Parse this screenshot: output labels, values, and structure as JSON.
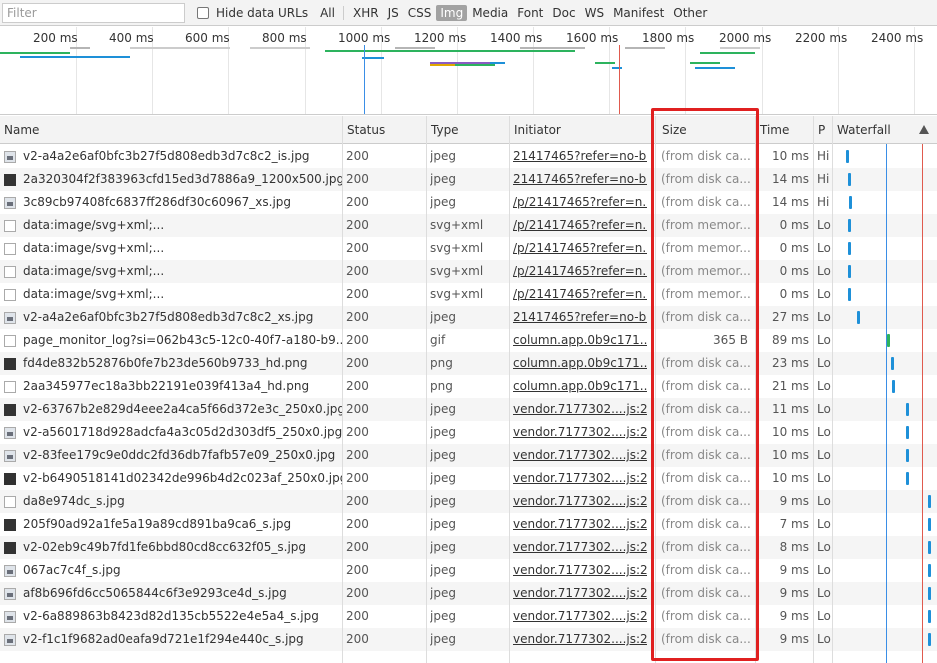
{
  "toolbar": {
    "filter_placeholder": "Filter",
    "hide_data_urls": "Hide data URLs",
    "types": [
      "All",
      "XHR",
      "JS",
      "CSS",
      "Img",
      "Media",
      "Font",
      "Doc",
      "WS",
      "Manifest",
      "Other"
    ],
    "active_type": "Img"
  },
  "overview": {
    "ticks": [
      "200 ms",
      "400 ms",
      "600 ms",
      "800 ms",
      "1000 ms",
      "1200 ms",
      "1400 ms",
      "1600 ms",
      "1800 ms",
      "2000 ms",
      "2200 ms",
      "2400 ms"
    ]
  },
  "columns": {
    "name": "Name",
    "status": "Status",
    "type": "Type",
    "initiator": "Initiator",
    "size": "Size",
    "time": "Time",
    "priority": "P",
    "waterfall": "Waterfall"
  },
  "rows": [
    {
      "name": "v2-a4a2e6af0bfc3b27f5d808edb3d7c8c2_is.jpg",
      "status": "200",
      "type": "jpeg",
      "initiator": "21417465?refer=no-b...",
      "size": "(from disk ca...",
      "time": "10 ms",
      "p": "Hi",
      "icon": "img"
    },
    {
      "name": "2a320304f2f383963cfd15ed3d7886a9_1200x500.jpg",
      "status": "200",
      "type": "jpeg",
      "initiator": "21417465?refer=no-b...",
      "size": "(from disk ca...",
      "time": "14 ms",
      "p": "Hi",
      "icon": "dark"
    },
    {
      "name": "3c89cb97408fc6837ff286df30c60967_xs.jpg",
      "status": "200",
      "type": "jpeg",
      "initiator": "/p/21417465?refer=n...",
      "size": "(from disk ca...",
      "time": "14 ms",
      "p": "Hi",
      "icon": "img"
    },
    {
      "name": "data:image/svg+xml;...",
      "status": "200",
      "type": "svg+xml",
      "initiator": "/p/21417465?refer=n...",
      "size": "(from memor...",
      "time": "0 ms",
      "p": "Lo",
      "icon": "blank"
    },
    {
      "name": "data:image/svg+xml;...",
      "status": "200",
      "type": "svg+xml",
      "initiator": "/p/21417465?refer=n...",
      "size": "(from memor...",
      "time": "0 ms",
      "p": "Lo",
      "icon": "blank"
    },
    {
      "name": "data:image/svg+xml;...",
      "status": "200",
      "type": "svg+xml",
      "initiator": "/p/21417465?refer=n...",
      "size": "(from memor...",
      "time": "0 ms",
      "p": "Lo",
      "icon": "blank"
    },
    {
      "name": "data:image/svg+xml;...",
      "status": "200",
      "type": "svg+xml",
      "initiator": "/p/21417465?refer=n...",
      "size": "(from memor...",
      "time": "0 ms",
      "p": "Lo",
      "icon": "blank"
    },
    {
      "name": "v2-a4a2e6af0bfc3b27f5d808edb3d7c8c2_xs.jpg",
      "status": "200",
      "type": "jpeg",
      "initiator": "21417465?refer=no-b...",
      "size": "(from disk ca...",
      "time": "27 ms",
      "p": "Lo",
      "icon": "img"
    },
    {
      "name": "page_monitor_log?si=062b43c5-12c0-40f7-a180-b9...",
      "status": "200",
      "type": "gif",
      "initiator": "column.app.0b9c171...",
      "size": "365 B",
      "time": "89 ms",
      "p": "Lo",
      "icon": "blank"
    },
    {
      "name": "fd4de832b52876b0fe7b23de560b9733_hd.png",
      "status": "200",
      "type": "png",
      "initiator": "column.app.0b9c171...",
      "size": "(from disk ca...",
      "time": "23 ms",
      "p": "Lo",
      "icon": "dark"
    },
    {
      "name": "2aa345977ec18a3bb22191e039f413a4_hd.png",
      "status": "200",
      "type": "png",
      "initiator": "column.app.0b9c171...",
      "size": "(from disk ca...",
      "time": "21 ms",
      "p": "Lo",
      "icon": "blank"
    },
    {
      "name": "v2-63767b2e829d4eee2a4ca5f66d372e3c_250x0.jpg",
      "status": "200",
      "type": "jpeg",
      "initiator": "vendor.7177302....js:22",
      "size": "(from disk ca...",
      "time": "11 ms",
      "p": "Lo",
      "icon": "dark"
    },
    {
      "name": "v2-a5601718d928adcfa4a3c05d2d303df5_250x0.jpg",
      "status": "200",
      "type": "jpeg",
      "initiator": "vendor.7177302....js:22",
      "size": "(from disk ca...",
      "time": "10 ms",
      "p": "Lo",
      "icon": "img"
    },
    {
      "name": "v2-83fee179c9e0ddc2fd36db7fafb57e09_250x0.jpg",
      "status": "200",
      "type": "jpeg",
      "initiator": "vendor.7177302....js:22",
      "size": "(from disk ca...",
      "time": "10 ms",
      "p": "Lo",
      "icon": "img"
    },
    {
      "name": "v2-b6490518141d02342de996b4d2c023af_250x0.jpg",
      "status": "200",
      "type": "jpeg",
      "initiator": "vendor.7177302....js:22",
      "size": "(from disk ca...",
      "time": "10 ms",
      "p": "Lo",
      "icon": "dark"
    },
    {
      "name": "da8e974dc_s.jpg",
      "status": "200",
      "type": "jpeg",
      "initiator": "vendor.7177302....js:22",
      "size": "(from disk ca...",
      "time": "9 ms",
      "p": "Lo",
      "icon": "blank"
    },
    {
      "name": "205f90ad92a1fe5a19a89cd891ba9ca6_s.jpg",
      "status": "200",
      "type": "jpeg",
      "initiator": "vendor.7177302....js:22",
      "size": "(from disk ca...",
      "time": "7 ms",
      "p": "Lo",
      "icon": "dark"
    },
    {
      "name": "v2-02eb9c49b7fd1fe6bbd80cd8cc632f05_s.jpg",
      "status": "200",
      "type": "jpeg",
      "initiator": "vendor.7177302....js:22",
      "size": "(from disk ca...",
      "time": "8 ms",
      "p": "Lo",
      "icon": "dark"
    },
    {
      "name": "067ac7c4f_s.jpg",
      "status": "200",
      "type": "jpeg",
      "initiator": "vendor.7177302....js:22",
      "size": "(from disk ca...",
      "time": "9 ms",
      "p": "Lo",
      "icon": "img"
    },
    {
      "name": "af8b696fd6cc5065844c6f3e9293ce4d_s.jpg",
      "status": "200",
      "type": "jpeg",
      "initiator": "vendor.7177302....js:22",
      "size": "(from disk ca...",
      "time": "9 ms",
      "p": "Lo",
      "icon": "img"
    },
    {
      "name": "v2-6a889863b8423d82d135cb5522e4e5a4_s.jpg",
      "status": "200",
      "type": "jpeg",
      "initiator": "vendor.7177302....js:22",
      "size": "(from disk ca...",
      "time": "9 ms",
      "p": "Lo",
      "icon": "img"
    },
    {
      "name": "v2-f1c1f9682ad0eafa9d721e1f294e440c_s.jpg",
      "status": "200",
      "type": "jpeg",
      "initiator": "vendor.7177302....js:22",
      "size": "(from disk ca...",
      "time": "9 ms",
      "p": "Lo",
      "icon": "img"
    }
  ],
  "colors": {
    "highlight": "#e02020",
    "dom_content_loaded": "#3a8ee6",
    "load": "#e05a4e",
    "waterfall_bar": "#1e90d8",
    "active_filter": "#a2a2a2"
  }
}
